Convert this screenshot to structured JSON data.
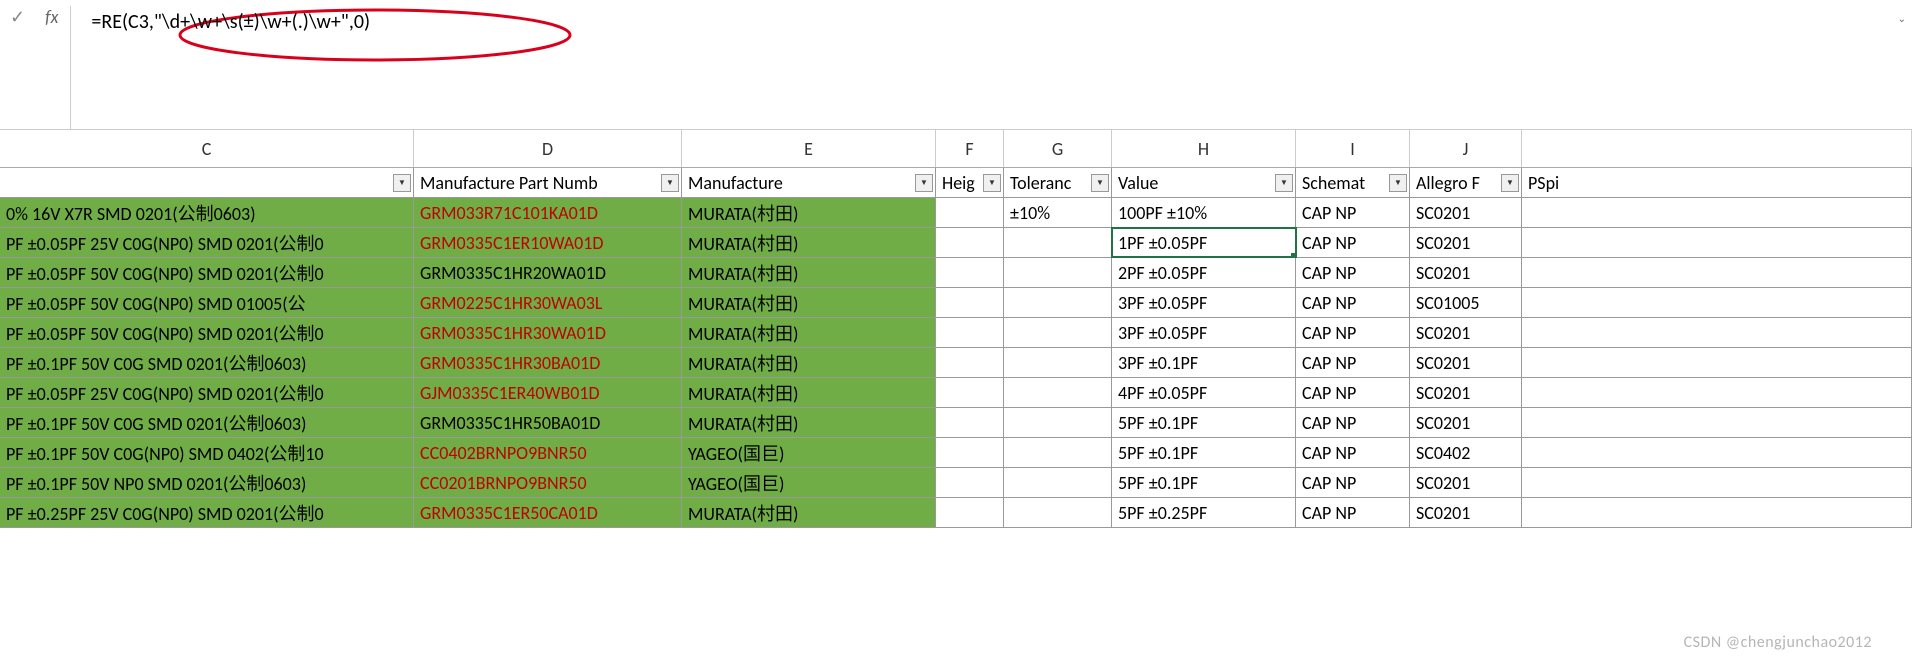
{
  "formula_bar": {
    "formula": "=RE(C3,\"\\d+\\w+\\s(±)\\w+(.)\\w+\",0)"
  },
  "columns": [
    "C",
    "D",
    "E",
    "F",
    "G",
    "H",
    "I",
    "J"
  ],
  "headers": {
    "C": "",
    "D": "Manufacture Part Numb",
    "E": "Manufacture",
    "F": "Heig",
    "G": "Toleranc",
    "H": "Value",
    "I": "Schemat",
    "J": "Allegro F",
    "K": "PSpi"
  },
  "rows": [
    {
      "C": "0% 16V X7R SMD 0201(公制0603)",
      "D": "GRM033R71C101KA01D",
      "Dred": true,
      "E": "MURATA(村田)",
      "F": "",
      "G": "±10%",
      "H": "100PF ±10%",
      "I": "CAP NP",
      "J": "SC0201"
    },
    {
      "C": "PF ±0.05PF 25V C0G(NP0) SMD 0201(公制0",
      "D": "GRM0335C1ER10WA01D",
      "Dred": true,
      "E": "MURATA(村田)",
      "F": "",
      "G": "",
      "H": "1PF ±0.05PF",
      "I": "CAP NP",
      "J": "SC0201",
      "active": true
    },
    {
      "C": "PF ±0.05PF 50V C0G(NP0) SMD 0201(公制0",
      "D": "GRM0335C1HR20WA01D",
      "Dred": false,
      "E": "MURATA(村田)",
      "F": "",
      "G": "",
      "H": "2PF ±0.05PF",
      "I": "CAP NP",
      "J": "SC0201"
    },
    {
      "C": "PF ±0.05PF 50V C0G(NP0) SMD 01005(公",
      "D": "GRM0225C1HR30WA03L",
      "Dred": true,
      "E": "MURATA(村田)",
      "F": "",
      "G": "",
      "H": "3PF ±0.05PF",
      "I": "CAP NP",
      "J": "SC01005"
    },
    {
      "C": "PF ±0.05PF 50V C0G(NP0) SMD 0201(公制0",
      "D": "GRM0335C1HR30WA01D",
      "Dred": true,
      "E": "MURATA(村田)",
      "F": "",
      "G": "",
      "H": "3PF ±0.05PF",
      "I": "CAP NP",
      "J": "SC0201"
    },
    {
      "C": "PF ±0.1PF 50V C0G SMD 0201(公制0603)",
      "D": "GRM0335C1HR30BA01D",
      "Dred": true,
      "E": "MURATA(村田)",
      "F": "",
      "G": "",
      "H": "3PF ±0.1PF",
      "I": "CAP NP",
      "J": "SC0201"
    },
    {
      "C": "PF ±0.05PF 25V C0G(NP0) SMD 0201(公制0",
      "D": "GJM0335C1ER40WB01D",
      "Dred": true,
      "E": "MURATA(村田)",
      "F": "",
      "G": "",
      "H": "4PF ±0.05PF",
      "I": "CAP NP",
      "J": "SC0201"
    },
    {
      "C": "PF ±0.1PF 50V C0G SMD 0201(公制0603)",
      "D": "GRM0335C1HR50BA01D",
      "Dred": false,
      "E": "MURATA(村田)",
      "F": "",
      "G": "",
      "H": "5PF ±0.1PF",
      "I": "CAP NP",
      "J": "SC0201"
    },
    {
      "C": "PF ±0.1PF 50V C0G(NP0) SMD 0402(公制10",
      "D": "CC0402BRNPO9BNR50",
      "Dred": true,
      "E": "YAGEO(国巨)",
      "F": "",
      "G": "",
      "H": "5PF ±0.1PF",
      "I": "CAP NP",
      "J": "SC0402"
    },
    {
      "C": "PF ±0.1PF 50V NP0 SMD 0201(公制0603)",
      "D": "CC0201BRNPO9BNR50",
      "Dred": true,
      "E": "YAGEO(国巨)",
      "F": "",
      "G": "",
      "H": "5PF ±0.1PF",
      "I": "CAP NP",
      "J": "SC0201"
    },
    {
      "C": "PF ±0.25PF 25V C0G(NP0) SMD 0201(公制0",
      "D": "GRM0335C1ER50CA01D",
      "Dred": true,
      "E": "MURATA(村田)",
      "F": "",
      "G": "",
      "H": "5PF ±0.25PF",
      "I": "CAP NP",
      "J": "SC0201"
    }
  ],
  "watermark": "CSDN @chengjunchao2012"
}
